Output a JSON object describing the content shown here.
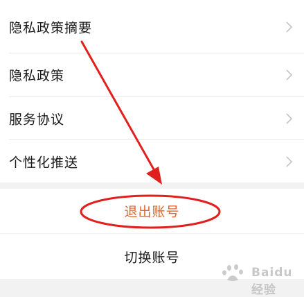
{
  "menu": {
    "items": [
      {
        "label": "隐私政策摘要",
        "icon": "chevron-right-icon"
      },
      {
        "label": "隐私政策",
        "icon": "chevron-right-icon"
      },
      {
        "label": "服务协议",
        "icon": "chevron-right-icon"
      },
      {
        "label": "个性化推送",
        "icon": "chevron-right-icon"
      }
    ]
  },
  "actions": {
    "logout_label": "退出账号",
    "switch_label": "切换账号"
  },
  "annotation": {
    "color": "#e0201f"
  },
  "colors": {
    "logout_text": "#e1642c",
    "background": "#f2f2f2"
  },
  "watermark": {
    "text": "Baidu经验"
  }
}
